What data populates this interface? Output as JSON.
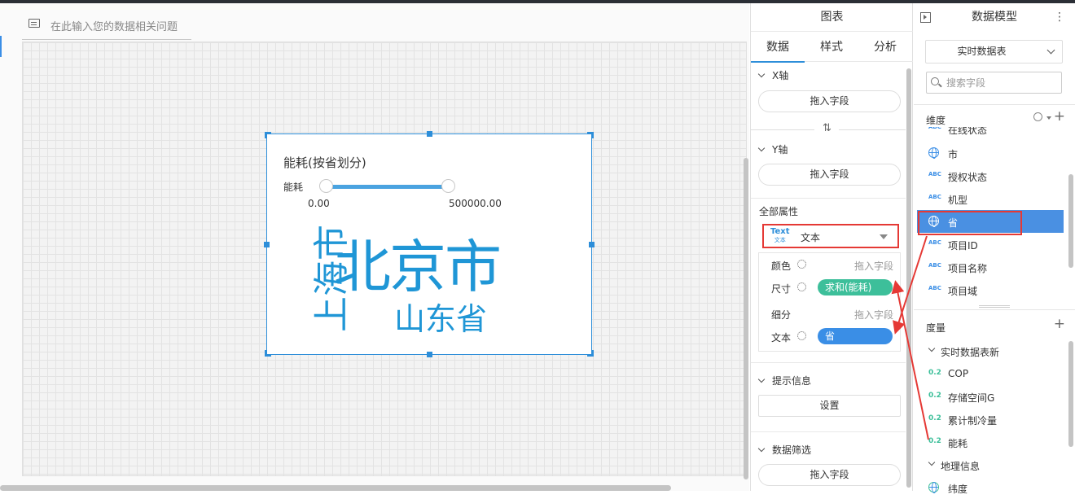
{
  "query": {
    "placeholder": "在此输入您的数据相关问题"
  },
  "widget": {
    "title": "能耗(按省划分)",
    "legend_label": "能耗",
    "range_min": "0.00",
    "range_max": "500000.00",
    "words": [
      "北京市",
      "上海市",
      "山东省"
    ],
    "color": "#1f96d6"
  },
  "chart_panel": {
    "title": "图表",
    "tabs": [
      "数据",
      "样式",
      "分析"
    ],
    "active_tab": "数据",
    "x_axis": {
      "title": "X轴",
      "placeholder": "拖入字段"
    },
    "y_axis": {
      "title": "Y轴",
      "placeholder": "拖入字段"
    },
    "all_props_title": "全部属性",
    "chart_type": {
      "icon_text": "Text",
      "icon_sub": "文本",
      "label": "文本"
    },
    "props": [
      {
        "label": "颜色",
        "value": "拖入字段"
      },
      {
        "label": "尺寸",
        "pill": "求和(能耗)",
        "pill_color": "#3dbf9a"
      },
      {
        "label": "细分",
        "value": "拖入字段"
      },
      {
        "label": "文本",
        "pill": "省",
        "pill_color": "#3a8ee6"
      }
    ],
    "tooltip": {
      "title": "提示信息",
      "button": "设置"
    },
    "filter": {
      "title": "数据筛选",
      "placeholder": "拖入字段"
    }
  },
  "model_panel": {
    "title": "数据模型",
    "more": "⋮",
    "dataset": "实时数据表",
    "search_placeholder": "搜索字段",
    "dimensions_title": "维度",
    "dimensions": [
      {
        "label": "在线状态",
        "icon": "abc"
      },
      {
        "label": "市",
        "icon": "globe"
      },
      {
        "label": "授权状态",
        "icon": "abc"
      },
      {
        "label": "机型",
        "icon": "abc"
      },
      {
        "label": "省",
        "icon": "globe",
        "selected": true
      },
      {
        "label": "项目ID",
        "icon": "abc"
      },
      {
        "label": "项目名称",
        "icon": "abc"
      },
      {
        "label": "项目域",
        "icon": "abc"
      }
    ],
    "measures_title": "度量",
    "measure_groups": [
      {
        "label": "实时数据表新",
        "items": [
          "COP",
          "存储空间G",
          "累计制冷量",
          "能耗"
        ]
      },
      {
        "label": "地理信息",
        "items": [
          "纬度"
        ]
      }
    ],
    "abc_icon": "ABC",
    "num_icon": "0.2"
  },
  "accent_color": "#2d8ed9",
  "annotation_color": "#e53935"
}
